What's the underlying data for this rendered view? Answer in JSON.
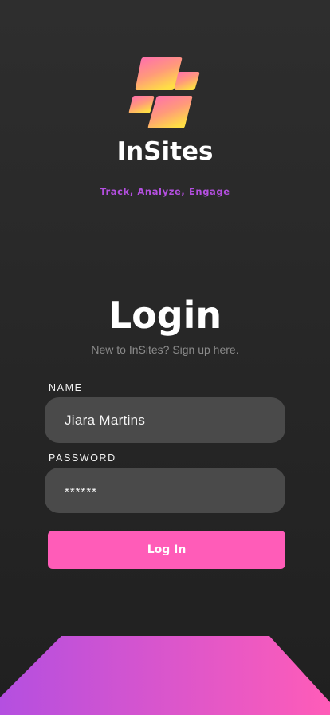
{
  "brand": {
    "logo_icon": "tiles-logo-icon",
    "name": "InSites",
    "tagline": "Track, Analyze, Engage",
    "tagline_color": "#b44fe0",
    "gradient_start": "#ff6fb0",
    "gradient_end": "#ffd84a"
  },
  "login": {
    "title": "Login",
    "signup_prompt": "New to InSites? Sign up here."
  },
  "form": {
    "name_label": "NAME",
    "name_value": "Jiara Martins",
    "password_label": "PASSWORD",
    "password_value": "******",
    "submit_label": "Log In"
  },
  "colors": {
    "background": "#2a2a2a",
    "field_bg": "#4a4a4a",
    "button_bg": "#ff5cb8",
    "footer_gradient_start": "#b44fe0",
    "footer_gradient_end": "#ff5cb8"
  }
}
